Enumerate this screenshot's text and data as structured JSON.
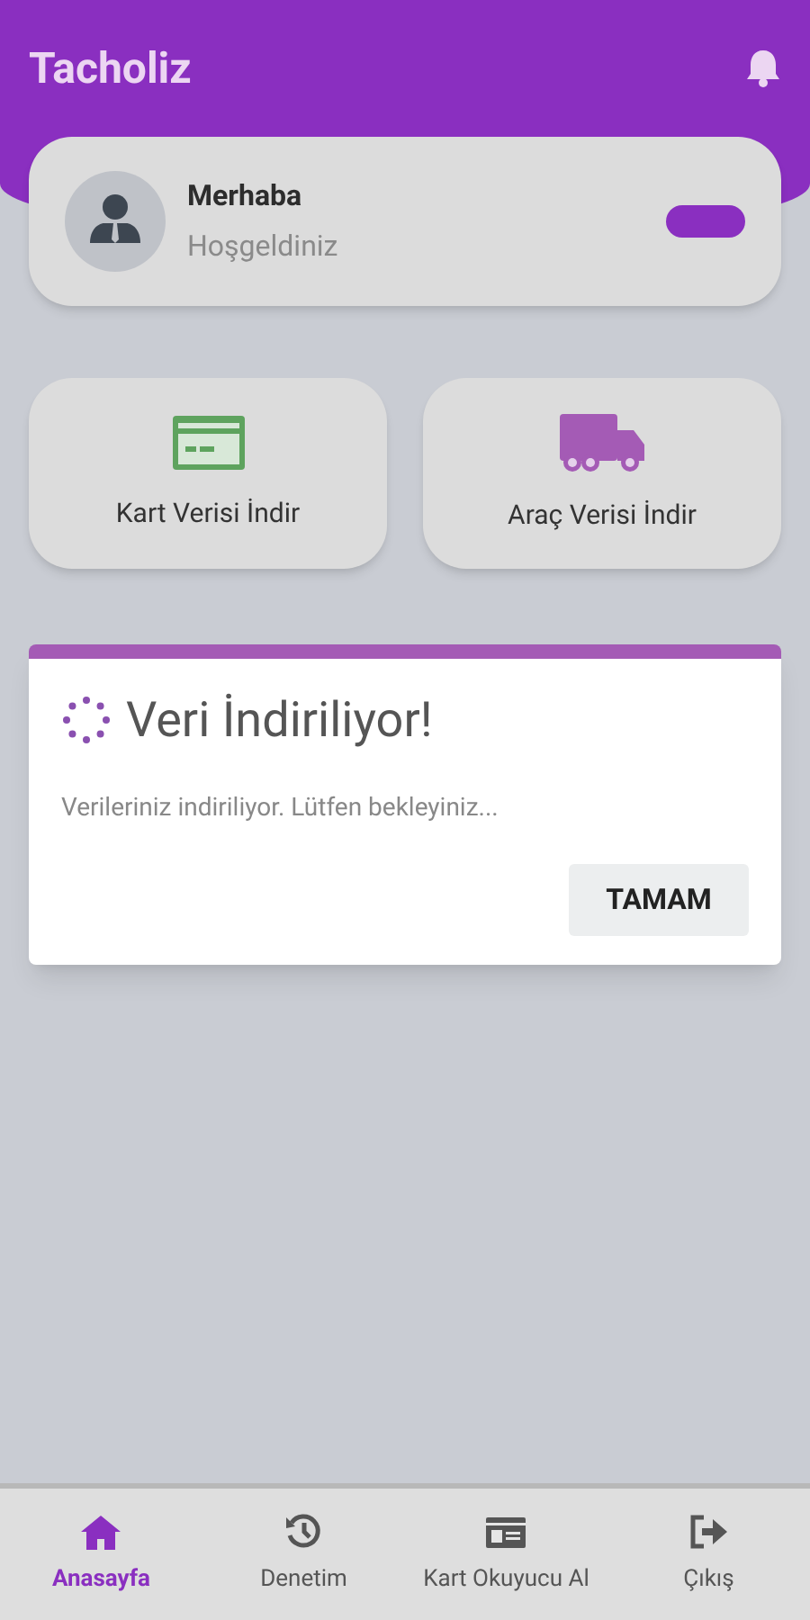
{
  "app_bar": {
    "title": "Tacholiz"
  },
  "profile": {
    "greeting": "Merhaba",
    "subtitle": "Hoşgeldiniz"
  },
  "actions": [
    {
      "kind": "card",
      "label": "Kart Verisi İndir"
    },
    {
      "kind": "truck",
      "label": "Araç Verisi İndir"
    }
  ],
  "dialog": {
    "title": "Veri İndiriliyor!",
    "message": "Verileriniz indiriliyor. Lütfen bekleyiniz...",
    "button": "TAMAM"
  },
  "bottom_nav": [
    {
      "kind": "home",
      "label": "Anasayfa",
      "selected": true
    },
    {
      "kind": "history",
      "label": "Denetim",
      "selected": false
    },
    {
      "kind": "card",
      "label": "Kart Okuyucu Al",
      "selected": false
    },
    {
      "kind": "logout",
      "label": "Çıkış",
      "selected": false
    }
  ]
}
